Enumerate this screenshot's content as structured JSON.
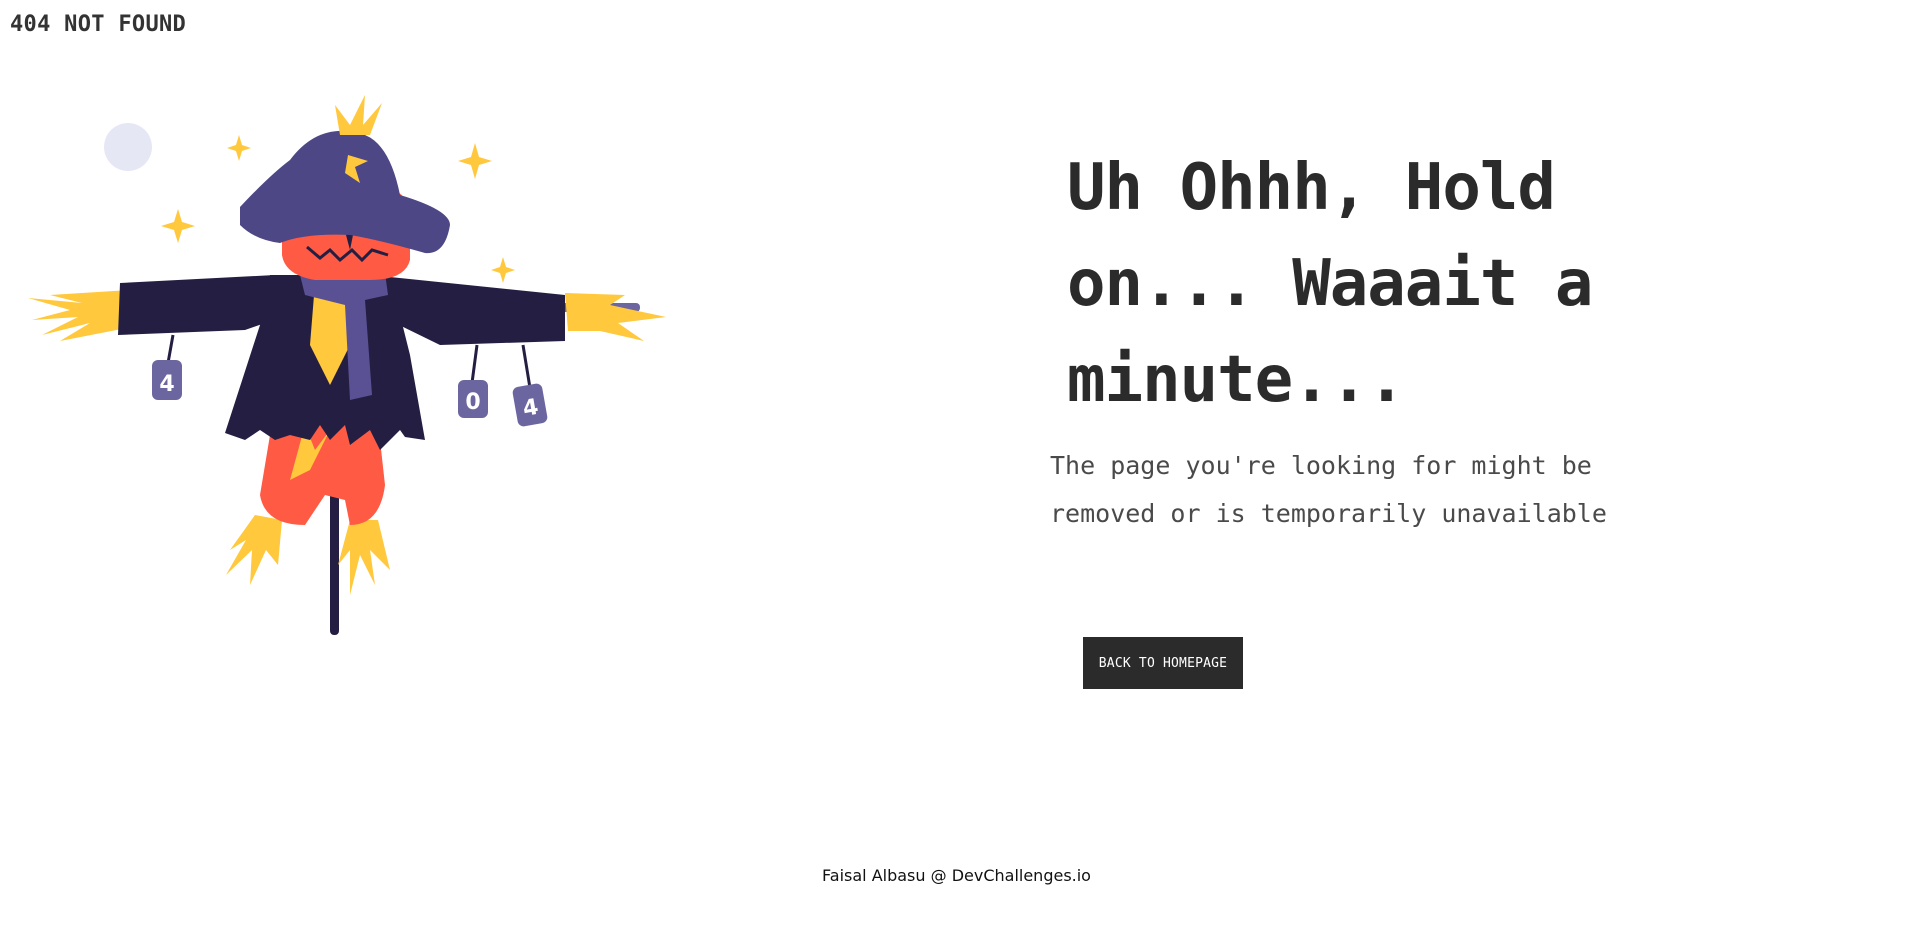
{
  "header": {
    "title": "404 NOT FOUND"
  },
  "illustration": {
    "icon": "scarecrow-illustration",
    "can_labels": [
      "4",
      "0",
      "4"
    ],
    "colors": {
      "hat": "#4d4786",
      "face": "#ff5a44",
      "coat": "#241f42",
      "straw": "#ffc83d",
      "pants": "#ff5a44",
      "scarf": "#5a5194",
      "can": "#6c66a0",
      "moon": "#e6e7f5"
    }
  },
  "main": {
    "headline": "Uh Ohhh, Hold on... Waaait a minute...",
    "message": "The page you're looking for might be removed or is temporarily unavailable",
    "button_label": "BACK TO HOMEPAGE"
  },
  "footer": {
    "credit": "Faisal Albasu @ DevChallenges.io"
  },
  "theme": {
    "text": "#2b2b2b",
    "button_bg": "#2b2b2b",
    "button_text": "#ffffff",
    "background": "#ffffff"
  }
}
